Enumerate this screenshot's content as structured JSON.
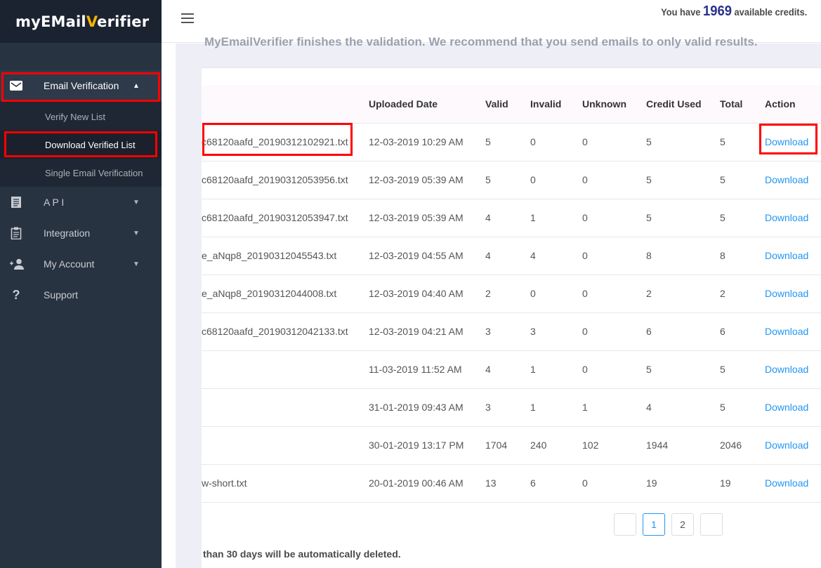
{
  "brand": {
    "logo_pre": "myE",
    "logo_m": "M",
    "logo_mid": "ail",
    "logo_v": "V",
    "logo_post": "erifier"
  },
  "sidebar": {
    "items": [
      {
        "label": "Email Verification",
        "icon": "envelope-icon",
        "expanded": true
      },
      {
        "label": "A P I",
        "icon": "document-icon"
      },
      {
        "label": "Integration",
        "icon": "clipboard-icon"
      },
      {
        "label": "My Account",
        "icon": "add-user-icon"
      },
      {
        "label": "Support",
        "icon": "question-icon"
      }
    ],
    "submenu": [
      {
        "label": "Verify New List"
      },
      {
        "label": "Download Verified List",
        "active": true
      },
      {
        "label": "Single Email Verification"
      }
    ]
  },
  "header": {
    "credits_prefix": "You have",
    "credits_value": "1969",
    "credits_suffix": "available credits."
  },
  "notices": {
    "top": "MyEmailVerifier finishes the validation. We recommend that you send emails to only valid results.",
    "bottom": "than 30 days will be automatically deleted."
  },
  "table": {
    "columns": [
      "",
      "Uploaded Date",
      "Valid",
      "Invalid",
      "Unknown",
      "Credit Used",
      "Total",
      "Action"
    ],
    "rows": [
      {
        "file": "c68120aafd_20190312102921.txt",
        "date": "12-03-2019 10:29 AM",
        "valid": "5",
        "invalid": "0",
        "unknown": "0",
        "credit": "5",
        "total": "5",
        "action": "Download"
      },
      {
        "file": "c68120aafd_20190312053956.txt",
        "date": "12-03-2019 05:39 AM",
        "valid": "5",
        "invalid": "0",
        "unknown": "0",
        "credit": "5",
        "total": "5",
        "action": "Download"
      },
      {
        "file": "c68120aafd_20190312053947.txt",
        "date": "12-03-2019 05:39 AM",
        "valid": "4",
        "invalid": "1",
        "unknown": "0",
        "credit": "5",
        "total": "5",
        "action": "Download"
      },
      {
        "file": "e_aNqp8_20190312045543.txt",
        "date": "12-03-2019 04:55 AM",
        "valid": "4",
        "invalid": "4",
        "unknown": "0",
        "credit": "8",
        "total": "8",
        "action": "Download"
      },
      {
        "file": "e_aNqp8_20190312044008.txt",
        "date": "12-03-2019 04:40 AM",
        "valid": "2",
        "invalid": "0",
        "unknown": "0",
        "credit": "2",
        "total": "2",
        "action": "Download"
      },
      {
        "file": "c68120aafd_20190312042133.txt",
        "date": "12-03-2019 04:21 AM",
        "valid": "3",
        "invalid": "3",
        "unknown": "0",
        "credit": "6",
        "total": "6",
        "action": "Download"
      },
      {
        "file": "",
        "date": "11-03-2019 11:52 AM",
        "valid": "4",
        "invalid": "1",
        "unknown": "0",
        "credit": "5",
        "total": "5",
        "action": "Download"
      },
      {
        "file": "",
        "date": "31-01-2019 09:43 AM",
        "valid": "3",
        "invalid": "1",
        "unknown": "1",
        "credit": "4",
        "total": "5",
        "action": "Download"
      },
      {
        "file": "",
        "date": "30-01-2019 13:17 PM",
        "valid": "1704",
        "invalid": "240",
        "unknown": "102",
        "credit": "1944",
        "total": "2046",
        "action": "Download"
      },
      {
        "file": "w-short.txt",
        "date": "20-01-2019 00:46 AM",
        "valid": "13",
        "invalid": "6",
        "unknown": "0",
        "credit": "19",
        "total": "19",
        "action": "Download"
      }
    ]
  },
  "pagination": {
    "prev": "",
    "pages": [
      "1",
      "2"
    ],
    "current": "1",
    "next": ""
  },
  "colors": {
    "sidebar": "#283341",
    "logo_bar": "#1b2331",
    "accent_link": "#2196f3",
    "credits_number": "#2a2f8f",
    "highlight": "#ff0000",
    "logo_accent": "#f4b400"
  }
}
